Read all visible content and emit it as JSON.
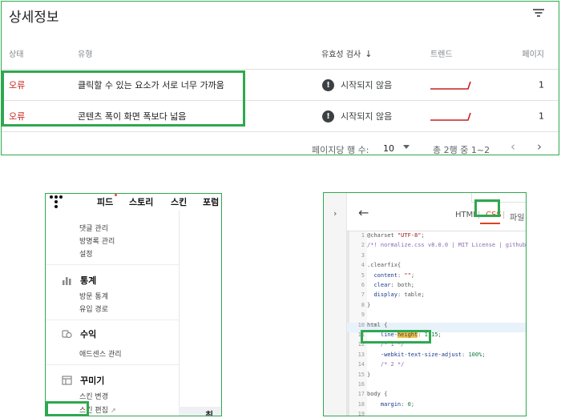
{
  "details": {
    "title": "상세정보",
    "columns": {
      "status": "상태",
      "type": "유형",
      "validation": "유효성 검사",
      "trend": "트렌드",
      "pages": "페이지"
    },
    "rows": [
      {
        "status": "오류",
        "type": "클릭할 수 있는 요소가 서로 너무 가까움",
        "validation": "시작되지 않음",
        "pages": "1"
      },
      {
        "status": "오류",
        "type": "콘텐츠 폭이 화면 폭보다 넓음",
        "validation": "시작되지 않음",
        "pages": "1"
      }
    ],
    "pagination": {
      "rows_per_page_label": "페이지당 행 수:",
      "rows_per_page": "10",
      "range": "총 2행 중 1~2"
    },
    "icons": {
      "filter": "filter-icon",
      "sort": "arrow-down-icon",
      "warning": "warning-icon",
      "prev": "chevron-left-icon",
      "next": "chevron-right-icon"
    },
    "colors": {
      "error": "#c5221f",
      "highlight": "#2fa84f"
    }
  },
  "blog_admin": {
    "nav": [
      "피드",
      "스토리",
      "스킨",
      "포럼"
    ],
    "menu_top": [
      "댓글 관리",
      "방명록 관리",
      "설정"
    ],
    "sections": [
      {
        "label": "통계",
        "icon": "bar-chart-icon",
        "items": [
          "방문 통계",
          "유입 경로"
        ]
      },
      {
        "label": "수익",
        "icon": "coins-icon",
        "items": [
          "애드센스 관리"
        ]
      },
      {
        "label": "꾸미기",
        "icon": "layout-icon",
        "items": [
          "스킨 변경",
          "스킨 편집"
        ]
      }
    ],
    "truncated_text": "최"
  },
  "code_editor": {
    "tabs": {
      "html": "HTML",
      "css": "CSS",
      "file": "파일"
    },
    "active_tab": "CSS",
    "lines": [
      {
        "n": "1",
        "t": "@charset \"UTF-8\";"
      },
      {
        "n": "2",
        "t": "/*! normalize.css v8.0.0 | MIT License | github"
      },
      {
        "n": "3",
        "t": ""
      },
      {
        "n": "4",
        "t": ".clearfix{"
      },
      {
        "n": "5",
        "t": "  content: \"\";"
      },
      {
        "n": "6",
        "t": "  clear: both;"
      },
      {
        "n": "7",
        "t": "  display: table;"
      },
      {
        "n": "8",
        "t": "}"
      },
      {
        "n": "9",
        "t": ""
      },
      {
        "n": "10",
        "t": "html {"
      },
      {
        "n": "11",
        "t": "    line-height: 1.15;"
      },
      {
        "n": "12",
        "t": "    /* 1 */"
      },
      {
        "n": "13",
        "t": "    -webkit-text-size-adjust: 100%;"
      },
      {
        "n": "14",
        "t": "    /* 2 */"
      },
      {
        "n": "15",
        "t": "}"
      },
      {
        "n": "16",
        "t": ""
      },
      {
        "n": "17",
        "t": "body {"
      },
      {
        "n": "18",
        "t": "    margin: 0;"
      },
      {
        "n": "19",
        "t": ""
      }
    ]
  }
}
